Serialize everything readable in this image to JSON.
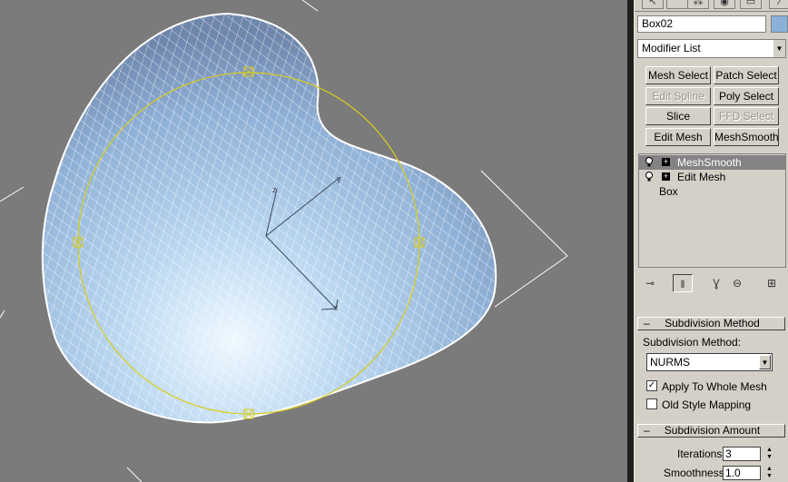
{
  "object_name": "Box02",
  "modifier_list": {
    "label": "Modifier List"
  },
  "modifier_buttons": [
    {
      "label": "Mesh Select",
      "enabled": true
    },
    {
      "label": "Patch Select",
      "enabled": true
    },
    {
      "label": "Edit Spline",
      "enabled": false
    },
    {
      "label": "Poly Select",
      "enabled": true
    },
    {
      "label": "Slice",
      "enabled": true
    },
    {
      "label": "FFD Select",
      "enabled": false
    },
    {
      "label": "Edit Mesh",
      "enabled": true
    },
    {
      "label": "MeshSmooth",
      "enabled": true
    }
  ],
  "stack": [
    {
      "label": "MeshSmooth",
      "selected": true
    },
    {
      "label": "Edit Mesh",
      "selected": false
    },
    {
      "label": "Box",
      "selected": false
    }
  ],
  "stack_tools": [
    "pin-stack-icon",
    "show-end-result-icon",
    "make-unique-icon",
    "remove-modifier-icon",
    "configure-modifier-sets-icon"
  ],
  "subdivision_method": {
    "title": "Subdivision Method",
    "method_label": "Subdivision Method:",
    "method_value": "NURMS",
    "apply_whole_mesh": {
      "label": "Apply To Whole Mesh",
      "checked": true
    },
    "old_style_mapping": {
      "label": "Old Style Mapping",
      "checked": false
    }
  },
  "subdivision_amount": {
    "title": "Subdivision Amount",
    "iterations_label": "Iterations:",
    "iterations_value": "3",
    "smoothness_label": "Smoothness:",
    "smoothness_value": "1.0"
  },
  "colors": {
    "viewport_bg": "#7b7b7b",
    "mesh_wire": "#ffffff",
    "gizmo": "#d8cc18",
    "panel_bg": "#d4d0c8",
    "stack_selected": "#848284"
  }
}
